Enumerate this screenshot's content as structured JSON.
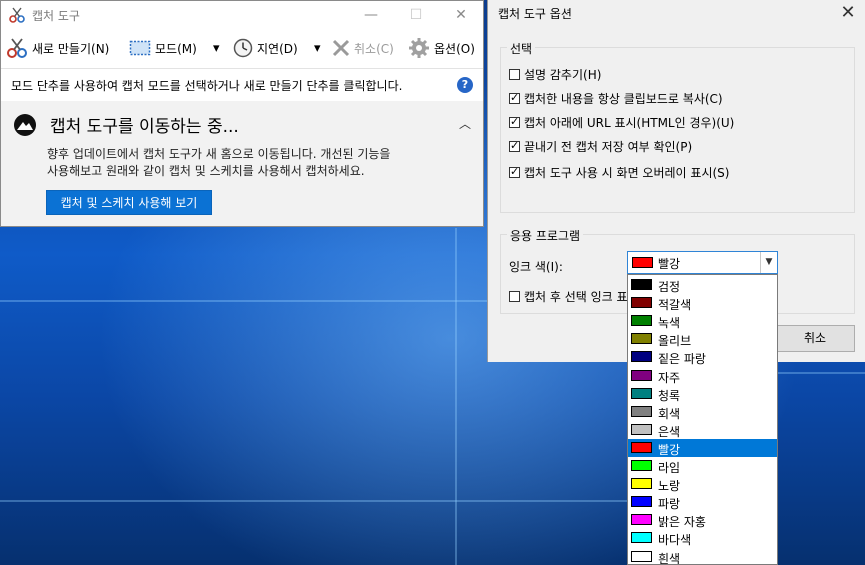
{
  "snipping_tool": {
    "title": "캡처 도구",
    "window_controls": {
      "minimize": "—",
      "maximize": "☐",
      "close": "✕"
    },
    "toolbar": {
      "new_label": "새로 만들기(N)",
      "mode_label": "모드(M)",
      "delay_label": "지연(D)",
      "cancel_label": "취소(C)",
      "options_label": "옵션(O)",
      "dropdown_arrow": "▾"
    },
    "info_text": "모드 단추를 사용하여 캡처 모드를 선택하거나 새로 만들기 단추를 클릭합니다.",
    "help_glyph": "?",
    "banner": {
      "title": "캡처 도구를 이동하는 중...",
      "body_line1": "향후 업데이트에서 캡처 도구가 새 홈으로 이동됩니다. 개선된 기능을",
      "body_line2": "사용해보고 원래와 같이 캡처 및 스케치를 사용해서 캡처하세요.",
      "button_label": "캡처 및 스케치 사용해 보기",
      "chevron": "︿"
    }
  },
  "options_dialog": {
    "title": "캡처 도구 옵션",
    "close_glyph": "✕",
    "selection_group": {
      "label": "선택",
      "items": [
        {
          "label": "설명 감추기(H)",
          "checked": false
        },
        {
          "label": "캡처한 내용을 항상 클립보드로 복사(C)",
          "checked": true
        },
        {
          "label": "캡처 아래에 URL 표시(HTML인 경우)(U)",
          "checked": true
        },
        {
          "label": "끝내기 전 캡처 저장 여부 확인(P)",
          "checked": true
        },
        {
          "label": "캡처 도구 사용 시 화면 오버레이 표시(S)",
          "checked": true
        }
      ]
    },
    "app_group": {
      "label": "응용 프로그램",
      "ink_color_label": "잉크 색(I):",
      "ink_color_value": "빨강",
      "ink_color_hex": "#ff0000",
      "after_capture_label": "캡처 후 선택 잉크 표",
      "after_capture_checked": false
    },
    "cancel_label": "취소"
  },
  "ink_dropdown": {
    "selected": "빨강",
    "options": [
      {
        "label": "검정",
        "color": "#000000"
      },
      {
        "label": "적갈색",
        "color": "#800000"
      },
      {
        "label": "녹색",
        "color": "#008000"
      },
      {
        "label": "올리브",
        "color": "#808000"
      },
      {
        "label": "짙은 파랑",
        "color": "#000080"
      },
      {
        "label": "자주",
        "color": "#800080"
      },
      {
        "label": "청록",
        "color": "#008080"
      },
      {
        "label": "회색",
        "color": "#808080"
      },
      {
        "label": "은색",
        "color": "#c0c0c0"
      },
      {
        "label": "빨강",
        "color": "#ff0000"
      },
      {
        "label": "라임",
        "color": "#00ff00"
      },
      {
        "label": "노랑",
        "color": "#ffff00"
      },
      {
        "label": "파랑",
        "color": "#0000ff"
      },
      {
        "label": "밝은 자홍",
        "color": "#ff00ff"
      },
      {
        "label": "바다색",
        "color": "#00ffff"
      },
      {
        "label": "흰색",
        "color": "#ffffff"
      }
    ]
  }
}
